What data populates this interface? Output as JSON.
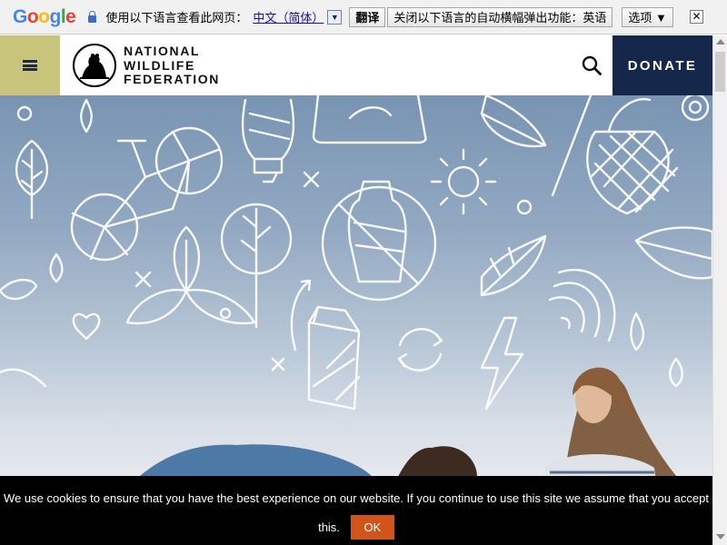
{
  "translate_bar": {
    "logo": {
      "g1": "G",
      "o1": "o",
      "o2": "o",
      "g2": "g",
      "l": "l",
      "e": "e"
    },
    "prompt": "使用以下语言查看此网页：",
    "language": "中文（简体）",
    "translate_button": "翻译",
    "disable_button": "关闭以下语言的自动横幅弹出功能：英语",
    "options": "选项 ▼",
    "close": "✕"
  },
  "header": {
    "logo_lines": [
      "NATIONAL",
      "WILDLIFE",
      "FEDERATION"
    ],
    "donate": "DONATE"
  },
  "cookie": {
    "message": "We use cookies to ensure that you have the best experience on our website. If you continue to use this site we assume that you accept",
    "message_end": "this.",
    "ok": "OK"
  },
  "colors": {
    "menu_bg": "#c8c47c",
    "donate_bg": "#15284b",
    "ok_bg": "#d1541a"
  },
  "icons": [
    "lock-icon",
    "menu-icon",
    "bear-logo-icon",
    "search-icon",
    "close-icon"
  ]
}
